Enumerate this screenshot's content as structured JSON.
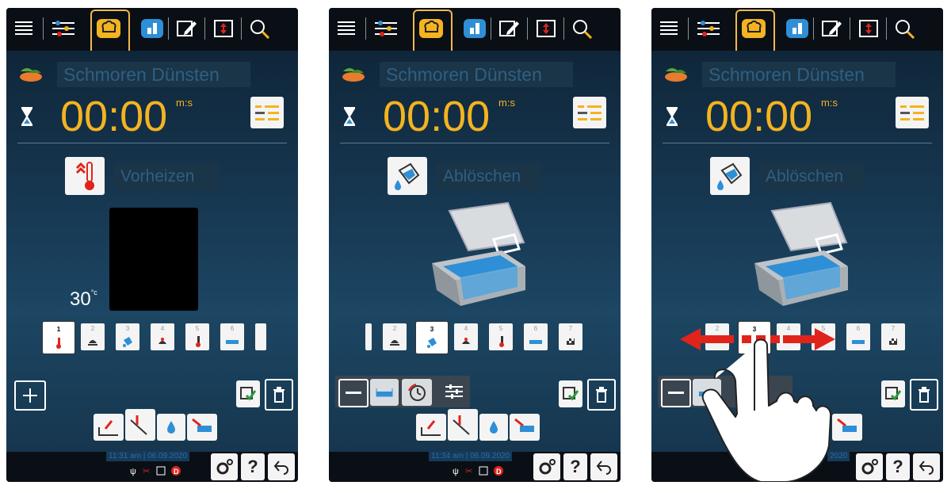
{
  "screens": [
    {
      "program_title": "Schmoren Dünsten",
      "time": "00:00",
      "time_unit": "m:s",
      "step_name": "Vorheizen",
      "temperature": "30",
      "temperature_unit": "°c",
      "steps": [
        "1",
        "2",
        "3",
        "4",
        "5",
        "6"
      ],
      "selected_step": "1",
      "datetime": "11:31 am | 06.09.2020"
    },
    {
      "program_title": "Schmoren Dünsten",
      "time": "00:00",
      "time_unit": "m:s",
      "step_name": "Ablöschen",
      "steps": [
        "2",
        "3",
        "4",
        "5",
        "6",
        "7"
      ],
      "selected_step": "3",
      "datetime": "11:34 am | 06.09.2020"
    },
    {
      "program_title": "Schmoren Dünsten",
      "time": "00:00",
      "time_unit": "m:s",
      "step_name": "Ablöschen",
      "steps": [
        "2",
        "3",
        "4",
        "5",
        "6",
        "7"
      ],
      "selected_step": "3",
      "datetime": "2020"
    }
  ],
  "bottom_buttons": {
    "help": "?"
  },
  "colors": {
    "accent": "#f4b320",
    "topbar": "#0a0f16",
    "arrow": "#e0241c"
  }
}
